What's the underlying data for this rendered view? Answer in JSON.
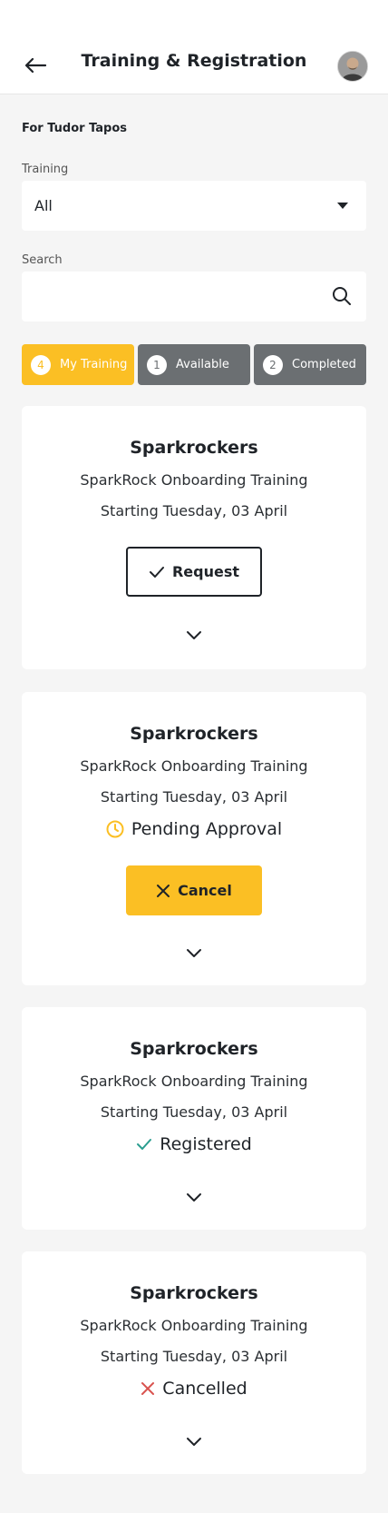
{
  "header": {
    "title": "Training & Registration"
  },
  "owner_label": "For Tudor Tapos",
  "training_filter": {
    "label": "Training",
    "value": "All"
  },
  "search": {
    "label": "Search",
    "value": "",
    "placeholder": ""
  },
  "tabs": [
    {
      "count": "4",
      "label": "My Training",
      "active": true
    },
    {
      "count": "1",
      "label": "Available",
      "active": false
    },
    {
      "count": "2",
      "label": "Completed",
      "active": false
    }
  ],
  "cards": [
    {
      "title": "Sparkrockers",
      "subtitle": "SparkRock Onboarding Training",
      "date": "Starting Tuesday, 03 April",
      "action": "Request"
    },
    {
      "title": "Sparkrockers",
      "subtitle": "SparkRock Onboarding Training",
      "date": "Starting Tuesday, 03 April",
      "status": "Pending Approval",
      "action": "Cancel"
    },
    {
      "title": "Sparkrockers",
      "subtitle": "SparkRock Onboarding Training",
      "date": "Starting Tuesday, 03 April",
      "status": "Registered"
    },
    {
      "title": "Sparkrockers",
      "subtitle": "SparkRock Onboarding Training",
      "date": "Starting Tuesday, 03 April",
      "status": "Cancelled"
    }
  ],
  "colors": {
    "accent": "#fbbf24",
    "inactive_tab": "#6b6f72",
    "success": "#2a9d8f",
    "danger": "#d9534f"
  }
}
